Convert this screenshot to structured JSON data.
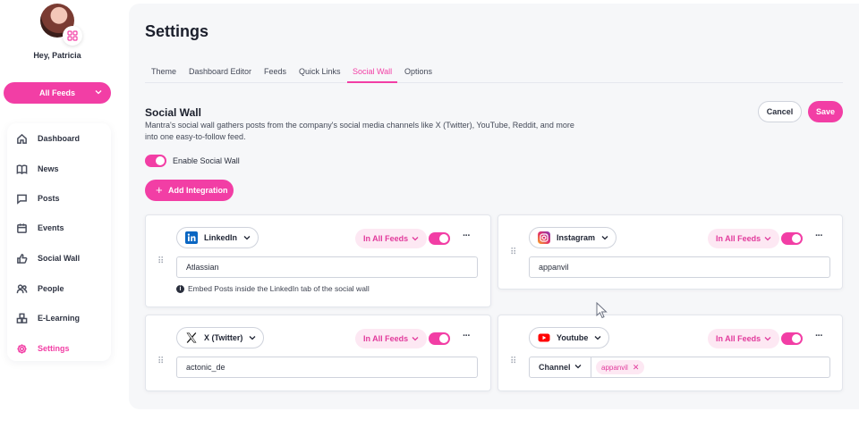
{
  "sidebar": {
    "greeting": "Hey, Patricia",
    "feeds_button": "All Feeds",
    "items": [
      {
        "label": "Dashboard",
        "icon": "home-icon"
      },
      {
        "label": "News",
        "icon": "book-icon"
      },
      {
        "label": "Posts",
        "icon": "chat-icon"
      },
      {
        "label": "Events",
        "icon": "calendar-icon"
      },
      {
        "label": "Social Wall",
        "icon": "thumbs-up-icon"
      },
      {
        "label": "People",
        "icon": "people-icon"
      },
      {
        "label": "E-Learning",
        "icon": "blocks-icon"
      },
      {
        "label": "Settings",
        "icon": "gear-icon",
        "active": true
      }
    ]
  },
  "main": {
    "title": "Settings",
    "tabs": [
      "Theme",
      "Dashboard Editor",
      "Feeds",
      "Quick Links",
      "Social Wall",
      "Options"
    ],
    "active_tab": "Social Wall",
    "section_title": "Social Wall",
    "description": "Mantra's social wall gathers posts from the company's social media channels like X (Twitter), YouTube, Reddit, and more into one easy-to-follow feed.",
    "cancel_label": "Cancel",
    "save_label": "Save",
    "enable_label": "Enable Social Wall",
    "enable_on": true,
    "add_label": "Add Integration"
  },
  "integrations": {
    "linkedin": {
      "provider": "LinkedIn",
      "feeds": "In All Feeds",
      "value": "Atlassian",
      "hint": "Embed Posts inside the LinkedIn tab of the social wall",
      "enabled": true
    },
    "instagram": {
      "provider": "Instagram",
      "feeds": "In All Feeds",
      "value": "appanvil",
      "enabled": true
    },
    "twitter": {
      "provider": "X (Twitter)",
      "feeds": "In All Feeds",
      "value": "actonic_de",
      "enabled": true
    },
    "youtube": {
      "provider": "Youtube",
      "feeds": "In All Feeds",
      "channel_label": "Channel",
      "chip": "appanvil",
      "enabled": true
    }
  },
  "colors": {
    "accent": "#f23ea5",
    "accent_soft": "#fde8f3",
    "panel": "#f6f7f9"
  }
}
